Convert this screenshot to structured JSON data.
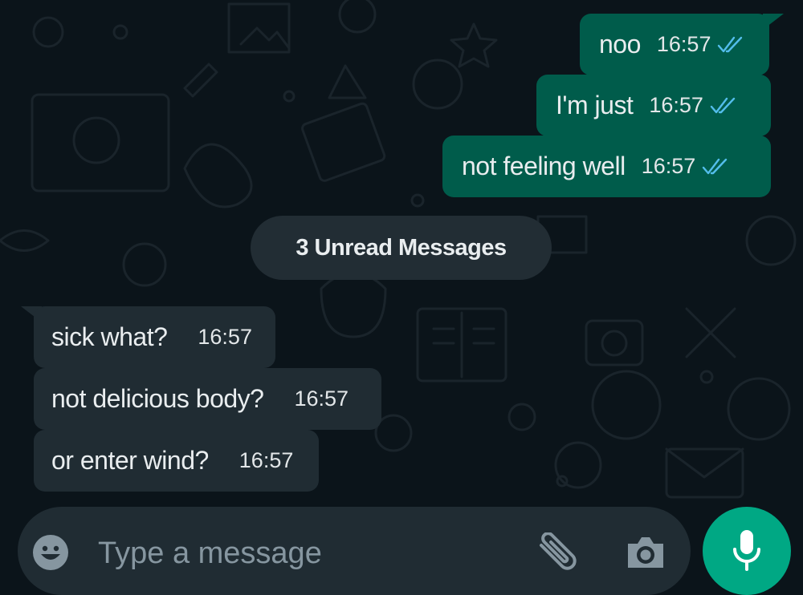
{
  "messages": [
    {
      "direction": "outgoing",
      "text": "noo",
      "time": "16:57",
      "status": "read"
    },
    {
      "direction": "outgoing",
      "text": "I'm just",
      "time": "16:57",
      "status": "read"
    },
    {
      "direction": "outgoing",
      "text": "not feeling well",
      "time": "16:57",
      "status": "read"
    },
    {
      "direction": "incoming",
      "text": "sick what?",
      "time": "16:57"
    },
    {
      "direction": "incoming",
      "text": "not delicious body?",
      "time": "16:57"
    },
    {
      "direction": "incoming",
      "text": "or enter wind?",
      "time": "16:57"
    }
  ],
  "unread_banner": "3 Unread Messages",
  "composer": {
    "placeholder": "Type a message",
    "emoji_icon": "emoji-icon",
    "attach_icon": "paperclip-icon",
    "camera_icon": "camera-icon"
  },
  "mic_icon": "microphone-icon",
  "colors": {
    "background": "#0b141a",
    "outgoing_bubble": "#005c4b",
    "incoming_bubble": "#202c33",
    "read_ticks": "#53bdeb",
    "accent": "#00a884",
    "icon": "#8696a0"
  }
}
